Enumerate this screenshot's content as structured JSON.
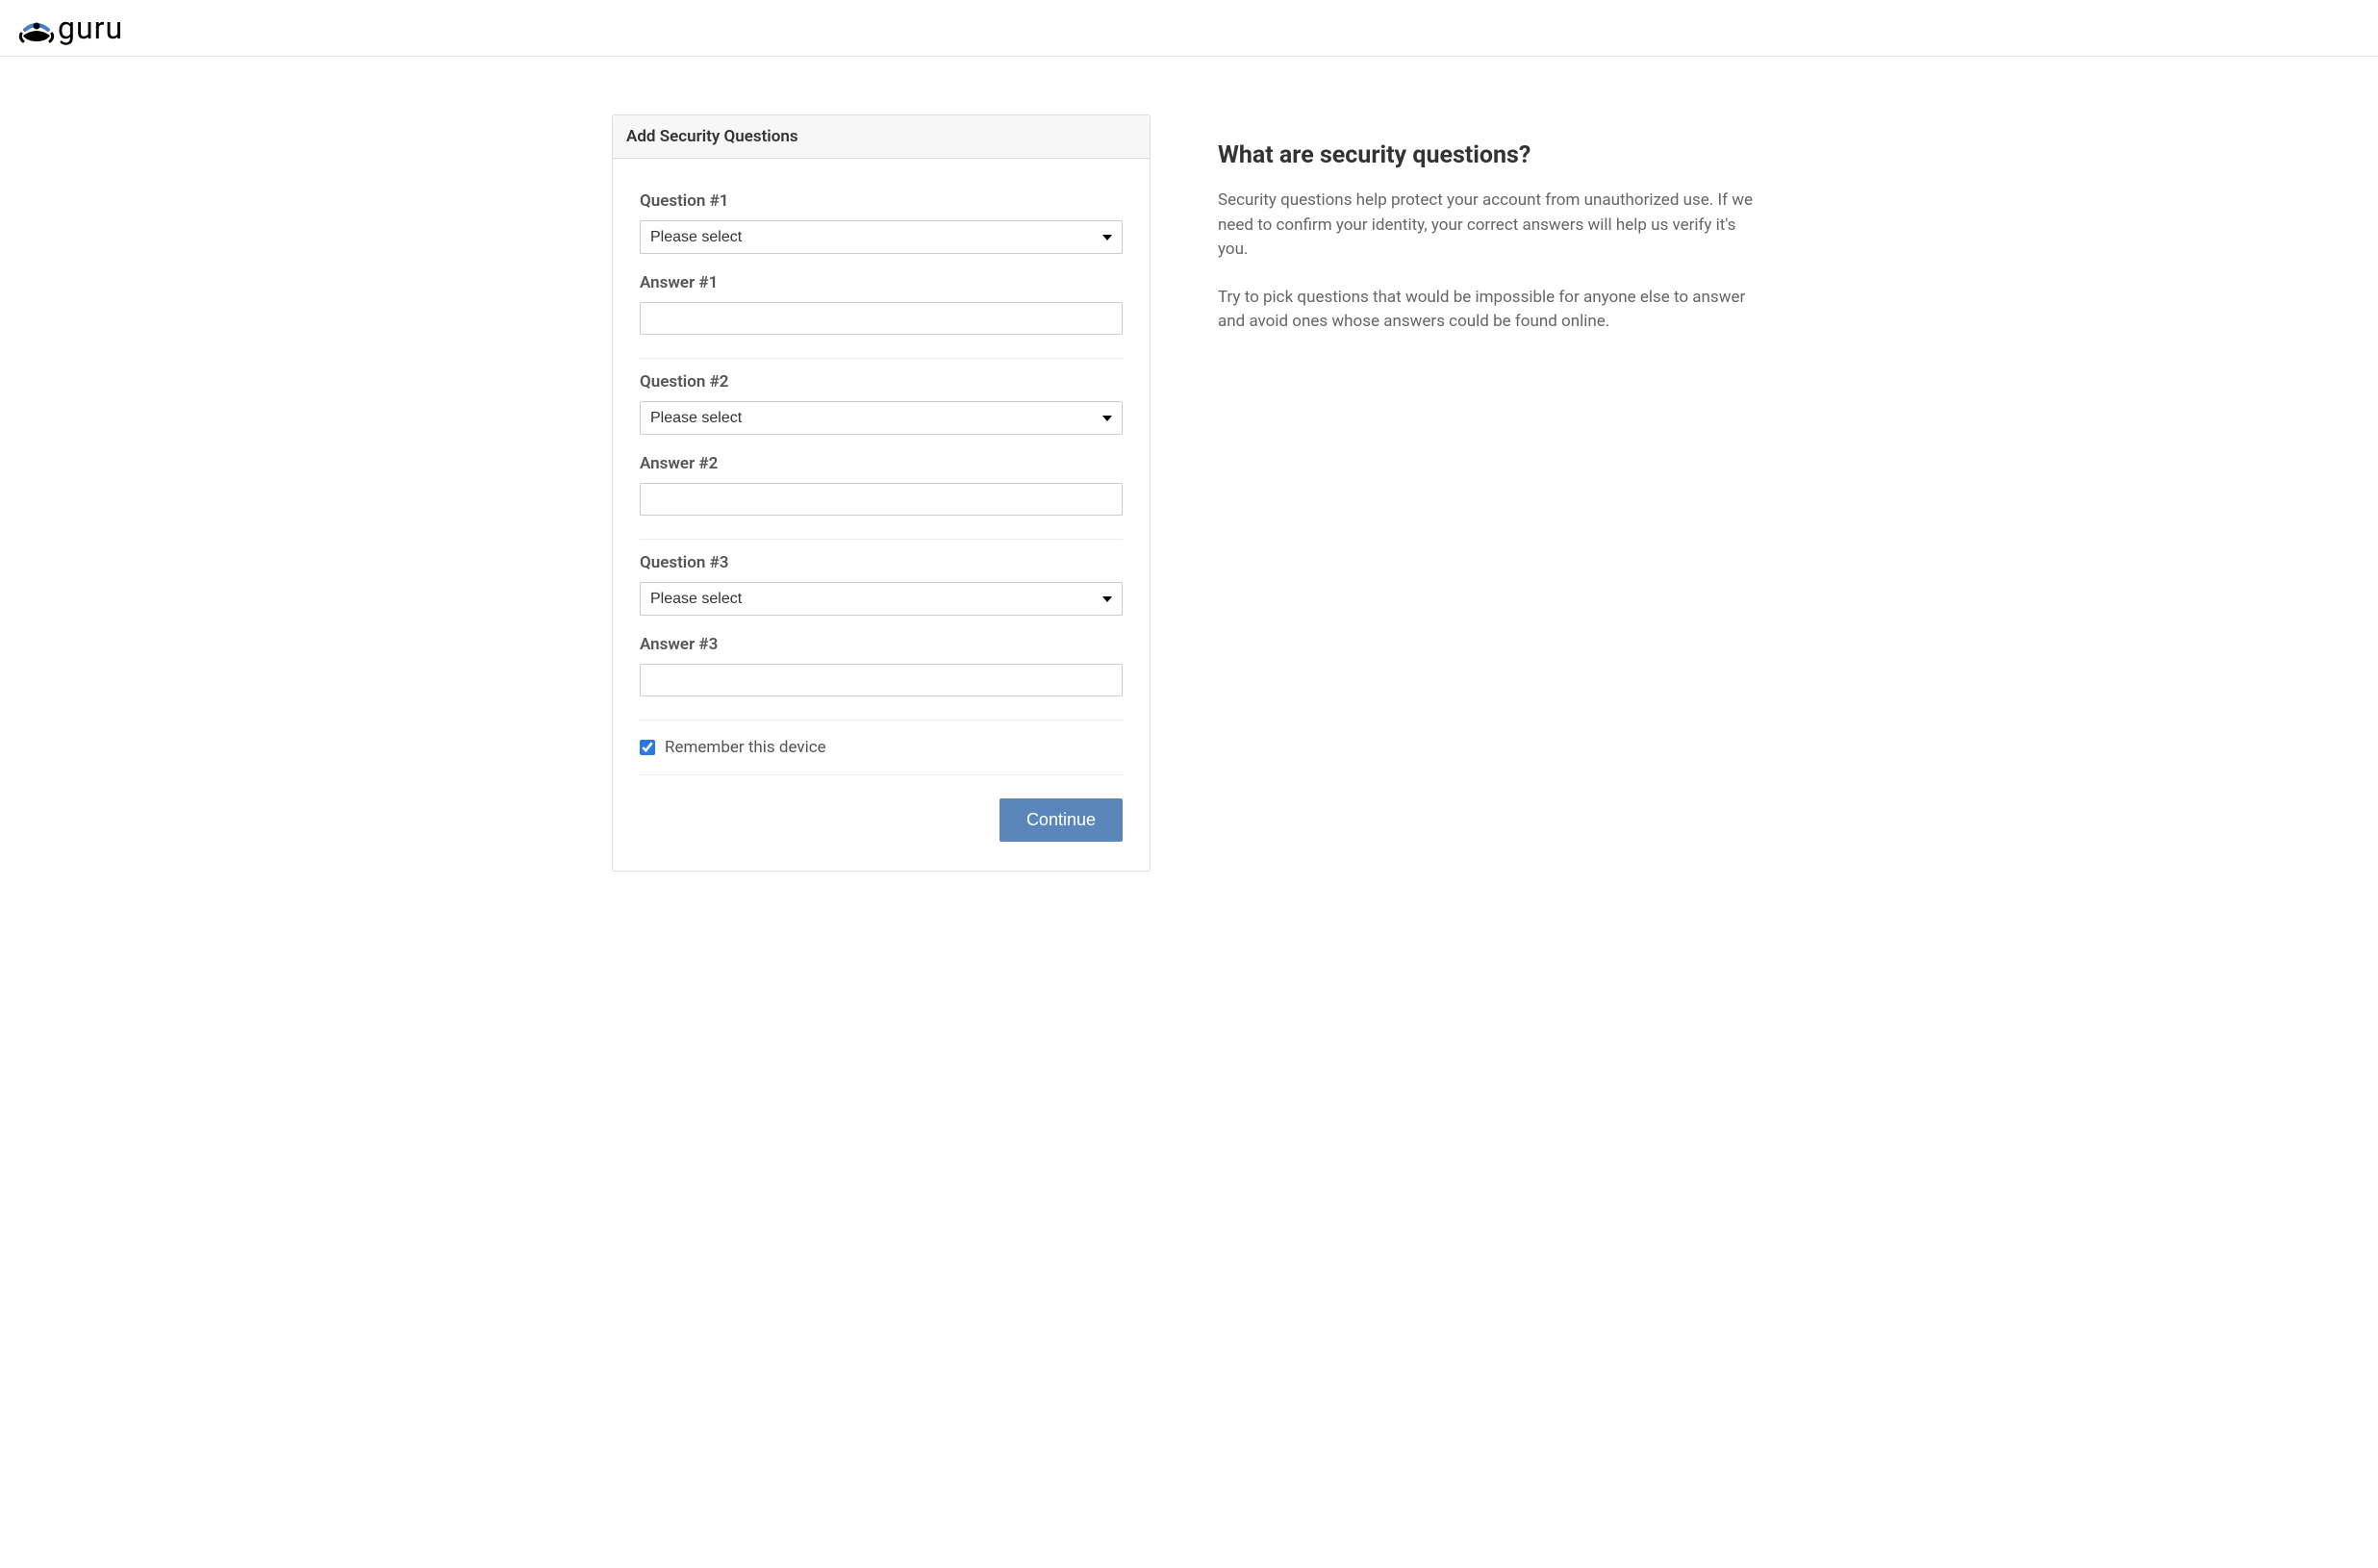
{
  "brand": {
    "name": "guru"
  },
  "panel": {
    "title": "Add Security Questions"
  },
  "questions": [
    {
      "questionLabel": "Question #1",
      "selectPlaceholder": "Please select",
      "answerLabel": "Answer #1",
      "answerValue": ""
    },
    {
      "questionLabel": "Question #2",
      "selectPlaceholder": "Please select",
      "answerLabel": "Answer #2",
      "answerValue": ""
    },
    {
      "questionLabel": "Question #3",
      "selectPlaceholder": "Please select",
      "answerLabel": "Answer #3",
      "answerValue": ""
    }
  ],
  "remember": {
    "label": "Remember this device",
    "checked": true
  },
  "actions": {
    "continueLabel": "Continue"
  },
  "info": {
    "title": "What are security questions?",
    "paragraph1": "Security questions help protect your account from unauthorized use. If we need to confirm your identity, your correct answers will help us verify it's you.",
    "paragraph2": "Try to pick questions that would be impossible for anyone else to answer and avoid ones whose answers could be found online."
  }
}
